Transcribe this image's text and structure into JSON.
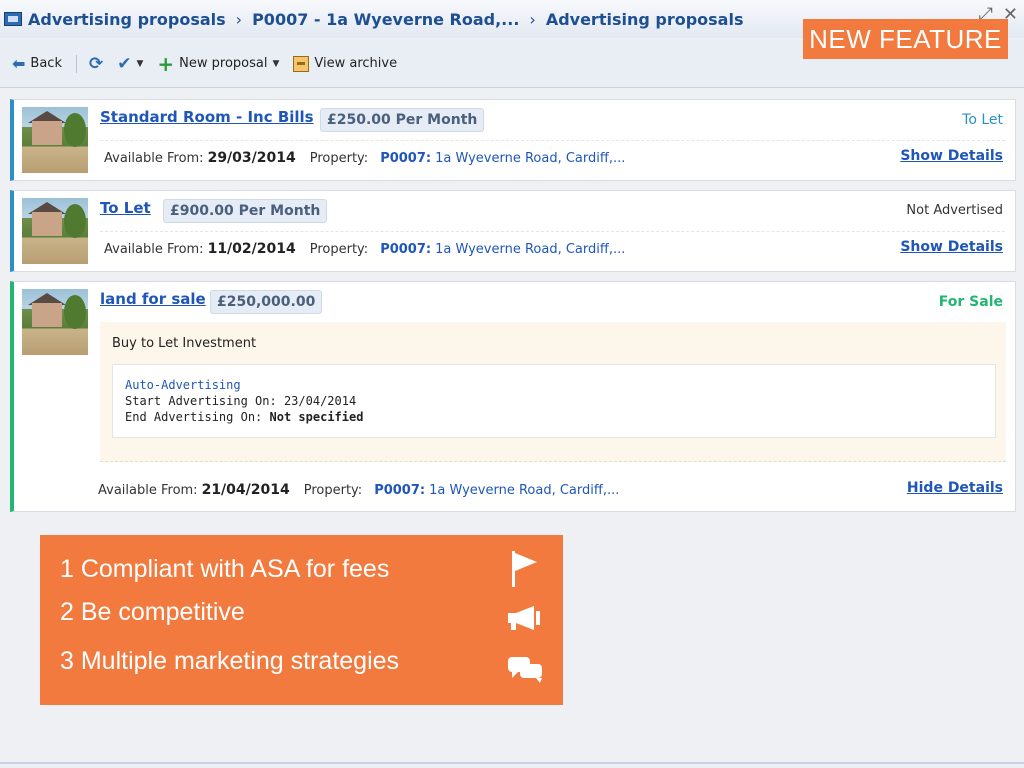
{
  "window": {
    "breadcrumb": [
      "Advertising proposals",
      "P0007 - 1a Wyeverne Road,...",
      "Advertising proposals"
    ],
    "separator": "›",
    "controls": {
      "expand": "⤢",
      "close": "✕"
    }
  },
  "banner": {
    "label": "NEW FEATURE",
    "color": "#f27a3f"
  },
  "toolbar": {
    "back": "Back",
    "new_proposal": "New proposal",
    "view_archive": "View archive"
  },
  "cards": [
    {
      "title": "Standard Room - Inc Bills",
      "price": "£250.00 Per Month",
      "status": "To Let",
      "available_label": "Available From:",
      "available_date": "29/03/2014",
      "property_label": "Property:",
      "property_code": "P0007:",
      "property_address": "1a Wyeverne Road, Cardiff,...",
      "details_link": "Show Details"
    },
    {
      "title": "To Let",
      "price": "£900.00 Per Month",
      "status": "Not Advertised",
      "available_label": "Available From:",
      "available_date": "11/02/2014",
      "property_label": "Property:",
      "property_code": "P0007:",
      "property_address": "1a Wyeverne Road, Cardiff,...",
      "details_link": "Show Details"
    },
    {
      "title": "land for sale",
      "price": "£250,000.00",
      "status": "For Sale",
      "description": "Buy to Let Investment",
      "auto_heading": "Auto-Advertising",
      "start_label": "Start Advertising On:",
      "start_value": "23/04/2014",
      "end_label": "End Advertising On:",
      "end_value": "Not specified",
      "available_label": "Available From:",
      "available_date": "21/04/2014",
      "property_label": "Property:",
      "property_code": "P0007:",
      "property_address": "1a Wyeverne Road, Cardiff,...",
      "details_link": "Hide Details"
    }
  ],
  "callout": {
    "items": [
      "1 Compliant with ASA for fees",
      "2 Be competitive",
      "3 Multiple marketing strategies"
    ],
    "icons": [
      "flag-icon",
      "megaphone-icon",
      "chat-icon"
    ]
  },
  "colors": {
    "accent_blue": "#2d8fc7",
    "accent_green": "#22b573",
    "link": "#1f56b8"
  }
}
